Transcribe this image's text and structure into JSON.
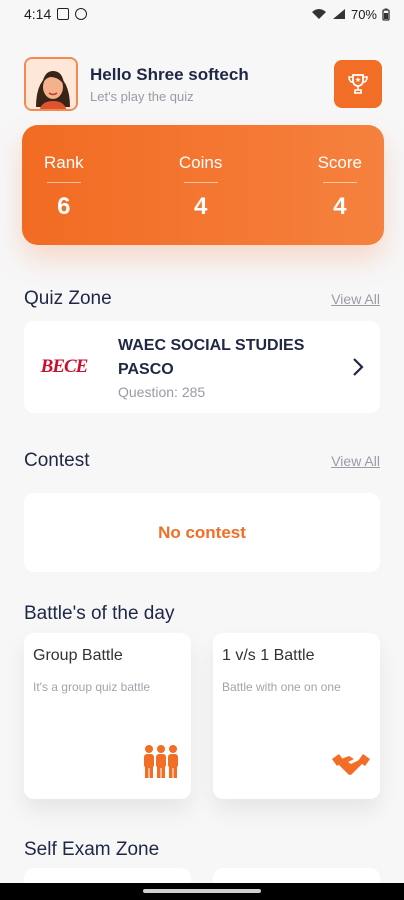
{
  "status_bar": {
    "time": "4:14",
    "battery": "70%"
  },
  "header": {
    "greeting": "Hello Shree softech",
    "subtitle": "Let's play the quiz"
  },
  "stats": [
    {
      "label": "Rank",
      "value": "6"
    },
    {
      "label": "Coins",
      "value": "4"
    },
    {
      "label": "Score",
      "value": "4"
    }
  ],
  "quiz_zone": {
    "title": "Quiz Zone",
    "view_all": "View All",
    "item": {
      "logo_text": "BECE",
      "title": "WAEC SOCIAL STUDIES PASCO",
      "subtitle": "Question: 285"
    }
  },
  "contest": {
    "title": "Contest",
    "view_all": "View All",
    "empty_text": "No contest"
  },
  "battles": {
    "title": "Battle's of the day",
    "items": [
      {
        "title": "Group Battle",
        "subtitle": "It's a group quiz battle"
      },
      {
        "title": "1 v/s 1 Battle",
        "subtitle": "Battle with one on one"
      }
    ]
  },
  "self_exam": {
    "title": "Self Exam Zone"
  },
  "colors": {
    "accent": "#f26d25",
    "text_dark": "#1f2744",
    "muted": "#9a9aa6",
    "background": "#f7f7f8"
  }
}
